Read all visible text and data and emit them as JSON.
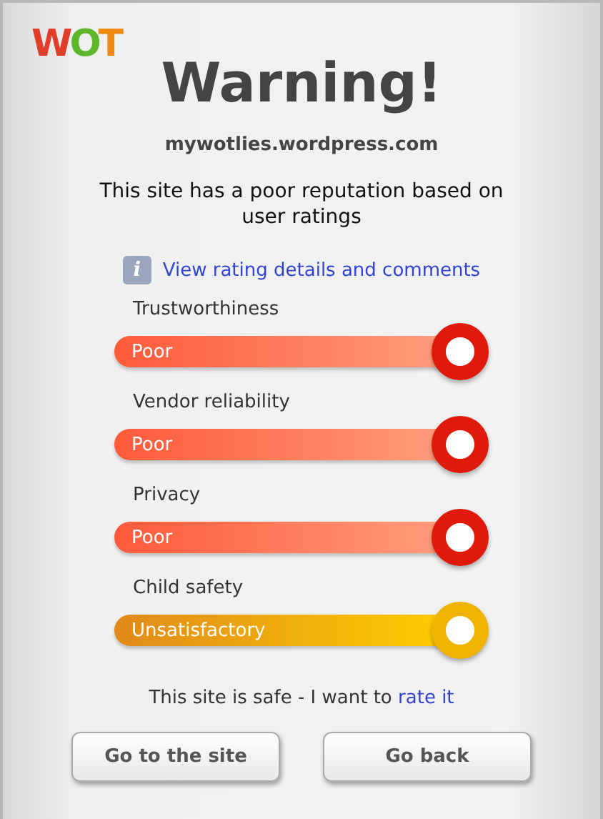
{
  "logo": "WOT",
  "title": "Warning!",
  "domain": "mywotlies.wordpress.com",
  "message": "This site has a poor reputation based on user ratings",
  "details_link": {
    "icon": "i",
    "label": "View rating details and comments"
  },
  "ratings": [
    {
      "label": "Trustworthiness",
      "value": "Poor",
      "color": "#e01a0a"
    },
    {
      "label": "Vendor reliability",
      "value": "Poor",
      "color": "#e01a0a"
    },
    {
      "label": "Privacy",
      "value": "Poor",
      "color": "#e01a0a"
    },
    {
      "label": "Child safety",
      "value": "Unsatisfactory",
      "color": "#f0b400"
    }
  ],
  "footer": {
    "text": "This site is safe - I want to",
    "link": "rate it"
  },
  "buttons": [
    "Go to the site",
    "Go back"
  ]
}
